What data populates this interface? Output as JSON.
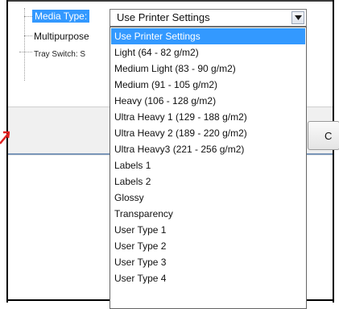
{
  "properties": {
    "media_type_label": "Media Type:",
    "multipurpose_label": "Multipurpose",
    "tray_switch_label": "Tray Switch: S"
  },
  "combo": {
    "value": "Use Printer Settings"
  },
  "dropdown": {
    "options": [
      "Use Printer Settings",
      "Light (64 - 82 g/m2)",
      "Medium Light (83 - 90 g/m2)",
      "Medium (91 - 105 g/m2)",
      "Heavy (106 - 128 g/m2)",
      "Ultra Heavy 1 (129 - 188 g/m2)",
      "Ultra Heavy 2 (189 - 220 g/m2)",
      "Ultra Heavy3 (221 - 256 g/m2)",
      "Labels 1",
      "Labels 2",
      "Glossy",
      "Transparency",
      "User Type 1",
      "User Type 2",
      "User Type 3",
      "User Type 4"
    ],
    "selected_index": 0
  },
  "buttons": {
    "ok_label": "C"
  },
  "colors": {
    "selection": "#3399ff",
    "arrow": "#e02020"
  }
}
